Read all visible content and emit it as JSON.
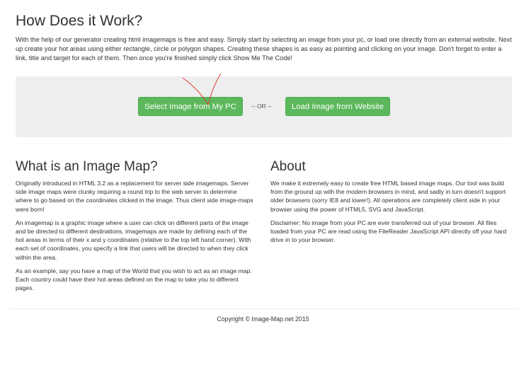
{
  "how": {
    "title": "How Does it Work?",
    "text": "With the help of our generator creating html imagemaps is free and easy. Simply start by selecting an image from your pc, or load one directly from an external website. Next up create your hot areas using either rectangle, circle or polygon shapes. Creating these shapes is as easy as pointing and clicking on your image. Don't forget to enter a link, title and target for each of them. Then once you're finished simply click Show Me The Code!"
  },
  "actions": {
    "select_label": "Select Image from My PC",
    "or_label": "-- OR --",
    "load_label": "Load Image from Website"
  },
  "what": {
    "title": "What is an Image Map?",
    "paragraphs": [
      "Originally introduced in HTML 3.2 as a replacement for server side imagemaps. Server side image maps were clunky requiring a round trip to the web server to determine where to go based on the coordinates clicked in the image. Thus client side image-maps were born!",
      "An imagemap is a graphic image where a user can click on different parts of the image and be directed to different destinations. imagemaps are made by defining each of the hot areas in terms of their x and y coordinates (relative to the top left hand corner). With each set of coordinates, you specify a link that users will be directed to when they click within the area.",
      "As an example, say you have a map of the World that you wish to act as an image map. Each country could have their hot areas defined on the map to take you to different pages."
    ]
  },
  "about": {
    "title": "About",
    "paragraphs": [
      "We make it extremely easy to create free HTML based image maps. Our tool was build from the ground up with the modern browsers in mind, and sadly in turn doesn't support older browsers (sorry IE8 and lower!). All operations are completely client side in your browser using the power of HTML5, SVG and JavaScript.",
      "Disclaimer: No image from your PC are ever transferred out of your browser. All files loaded from your PC are read using the FileReader JavaScript API directly off your hard drive in to your browser."
    ]
  },
  "footer": {
    "copyright": "Copyright © Image-Map.net 2015"
  },
  "colors": {
    "button_green": "#5cb85c",
    "panel_gray": "#eeeeee",
    "annotation_red": "#e03a2f"
  }
}
